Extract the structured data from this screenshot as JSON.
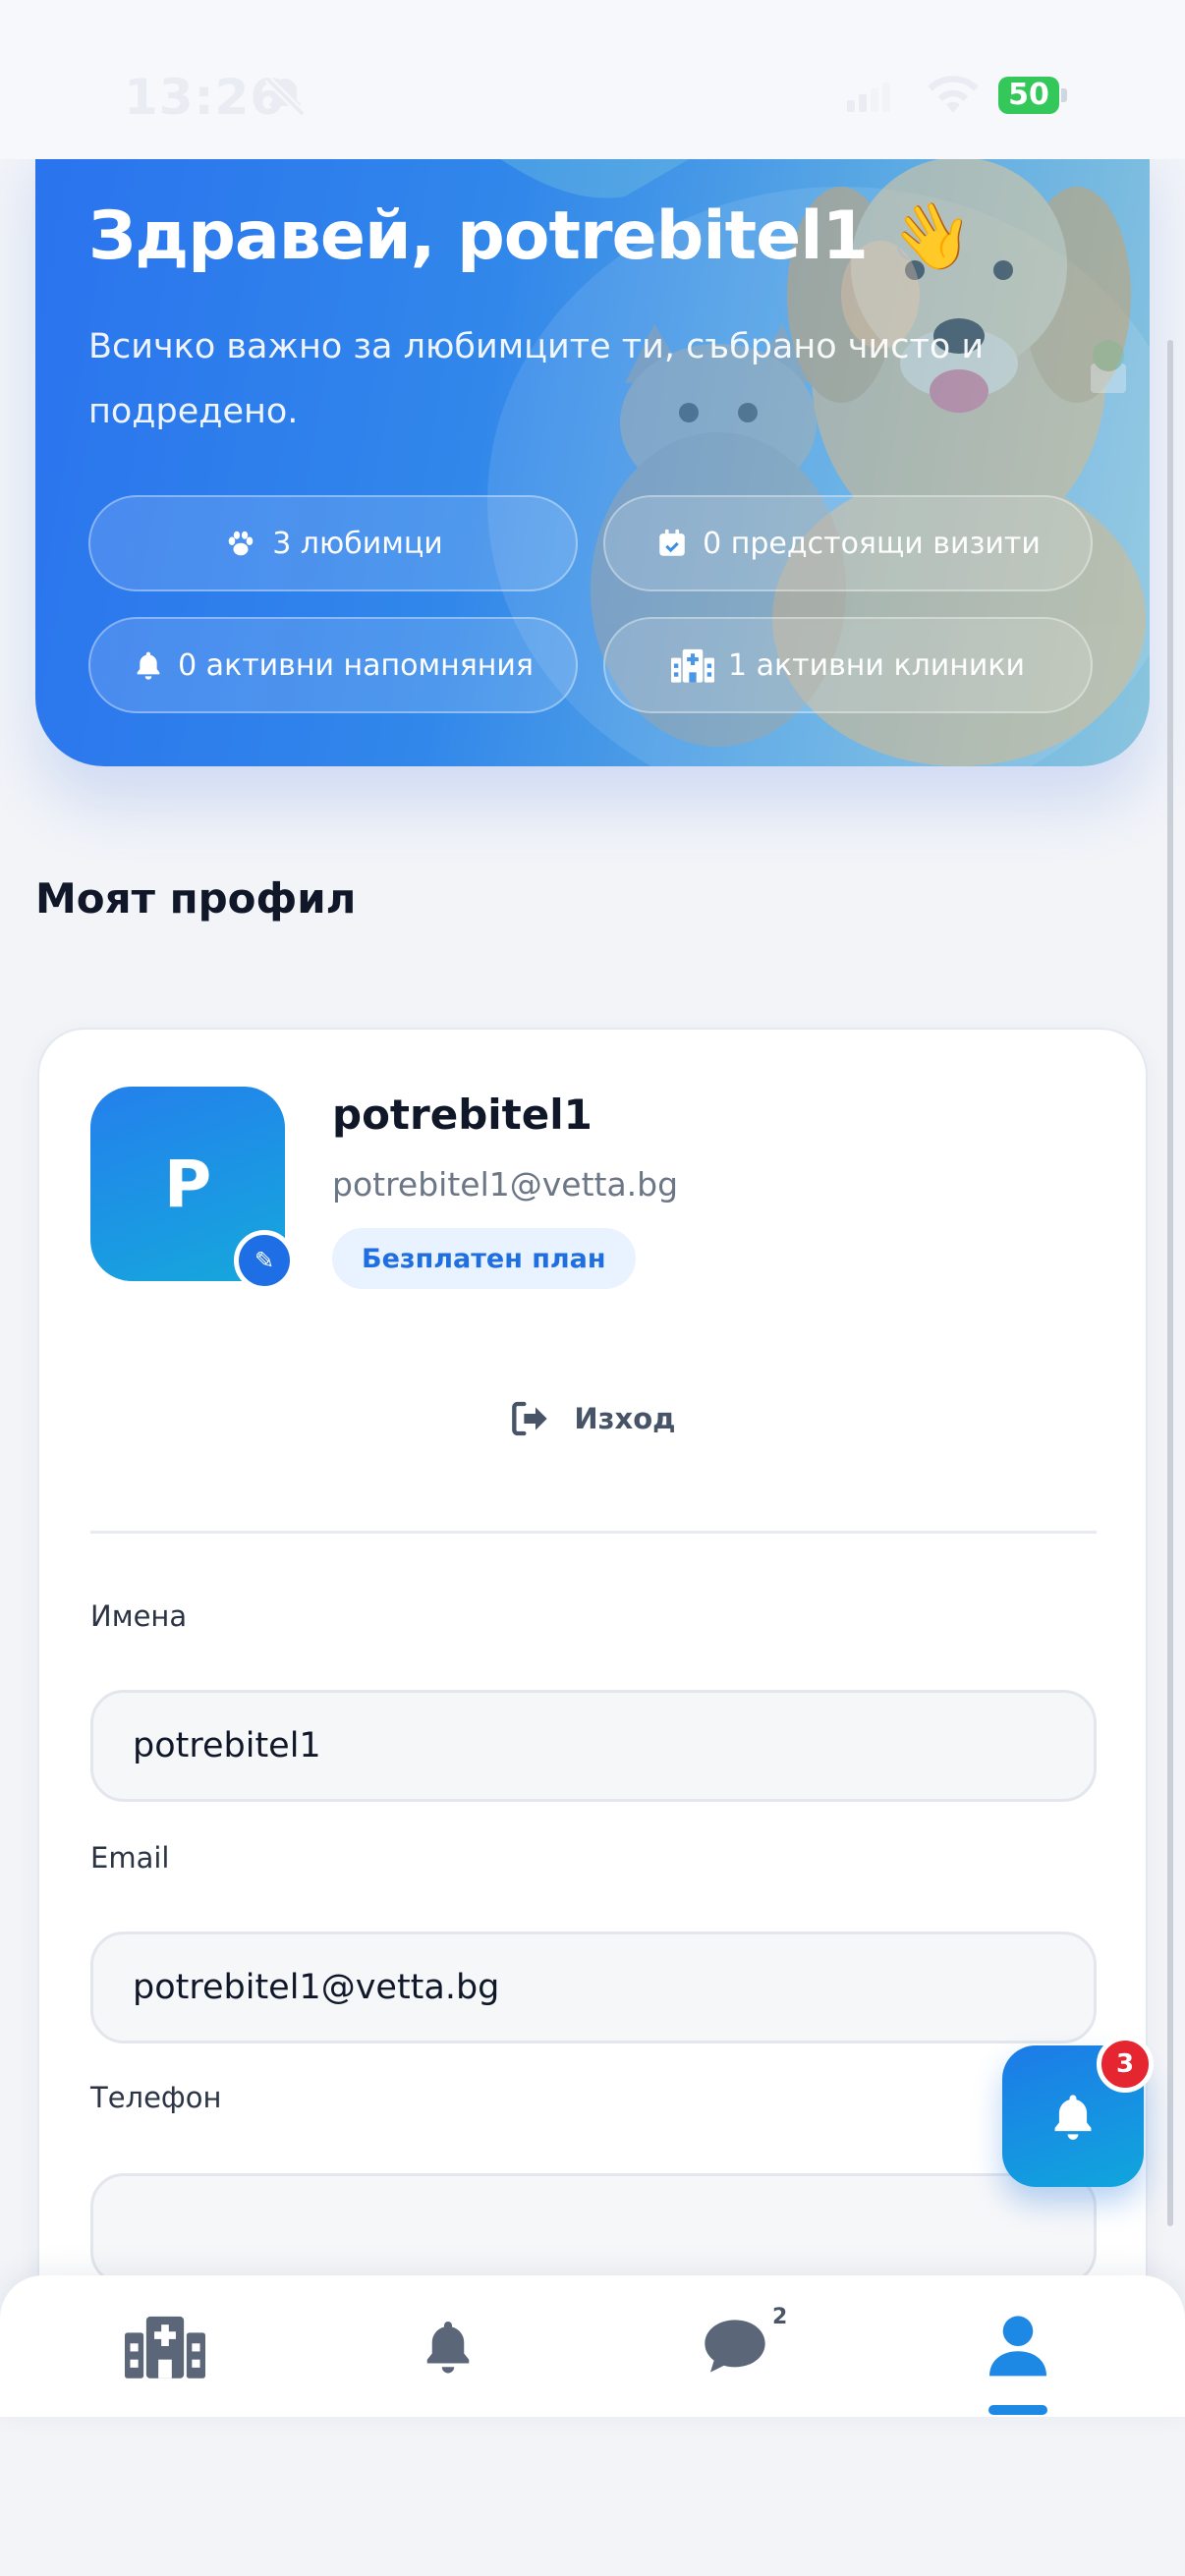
{
  "status_bar": {
    "time": "13:26",
    "battery": "50"
  },
  "hero": {
    "greeting": "Здравей, potrebitel1 👋",
    "subtitle": "Всичко важно за любимците ти, събрано чисто и подредено.",
    "stats": [
      {
        "icon": "paw-icon",
        "label": "3 любимци"
      },
      {
        "icon": "calendar-check-icon",
        "label": "0 предстоящи визити"
      },
      {
        "icon": "bell-icon",
        "label": "0 активни напомняния"
      },
      {
        "icon": "clinic-icon",
        "label": "1 активни клиники"
      }
    ]
  },
  "section_title": "Моят профил",
  "profile": {
    "avatar_initial": "P",
    "name": "potrebitel1",
    "email": "potrebitel1@vetta.bg",
    "plan": "Безплатен план",
    "logout_label": "Изход"
  },
  "form": {
    "name_label": "Имена",
    "name_value": "potrebitel1",
    "email_label": "Email",
    "email_value": "potrebitel1@vetta.bg",
    "phone_label": "Телефон",
    "phone_value": ""
  },
  "fab": {
    "icon": "bell-icon",
    "badge": "3"
  },
  "tab_bar": {
    "tabs": [
      {
        "icon": "clinic-icon",
        "active": false
      },
      {
        "icon": "bell-icon",
        "active": false
      },
      {
        "icon": "chat-icon",
        "active": false,
        "badge": "2"
      },
      {
        "icon": "user-icon",
        "active": true
      }
    ]
  },
  "colors": {
    "accent": "#1e88e5",
    "hero_start": "#2a73ee",
    "badge_red": "#e5252f",
    "plan_badge_bg": "#e9f2ff"
  }
}
